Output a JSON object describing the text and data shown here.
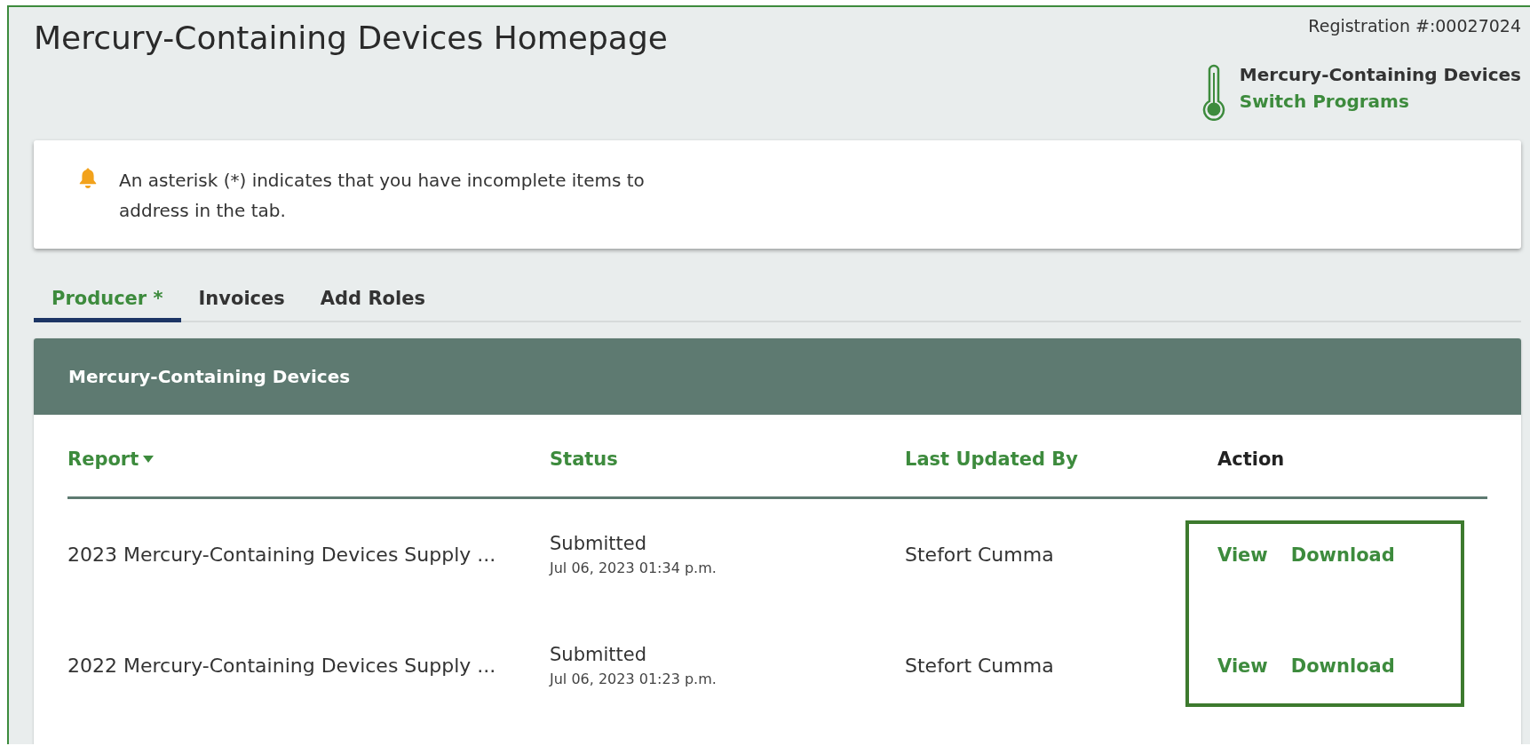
{
  "page": {
    "title": "Mercury-Containing Devices Homepage",
    "registration": "Registration #:00027024"
  },
  "program": {
    "name": "Mercury-Containing Devices",
    "switch_link": "Switch Programs"
  },
  "alert": {
    "text": "An asterisk (*) indicates that you have incomplete items to address in the tab."
  },
  "tabs": [
    {
      "label": "Producer *",
      "selected": true
    },
    {
      "label": "Invoices",
      "selected": false
    },
    {
      "label": "Add Roles",
      "selected": false
    }
  ],
  "panel": {
    "title": "Mercury-Containing Devices",
    "columns": [
      {
        "label": "Report",
        "sortable": true
      },
      {
        "label": "Status",
        "sortable": true
      },
      {
        "label": "Last Updated By",
        "sortable": true
      },
      {
        "label": "Action",
        "sortable": false
      }
    ],
    "rows": [
      {
        "report": "2023 Mercury-Containing Devices Supply ...",
        "status": "Submitted",
        "date": "Jul 06, 2023 01:34 p.m.",
        "updated_by": "Stefort Cumma",
        "actions": [
          "View",
          "Download"
        ]
      },
      {
        "report": "2022 Mercury-Containing Devices Supply ...",
        "status": "Submitted",
        "date": "Jul 06, 2023 01:23 p.m.",
        "updated_by": "Stefort Cumma",
        "actions": [
          "View",
          "Download"
        ]
      }
    ]
  }
}
